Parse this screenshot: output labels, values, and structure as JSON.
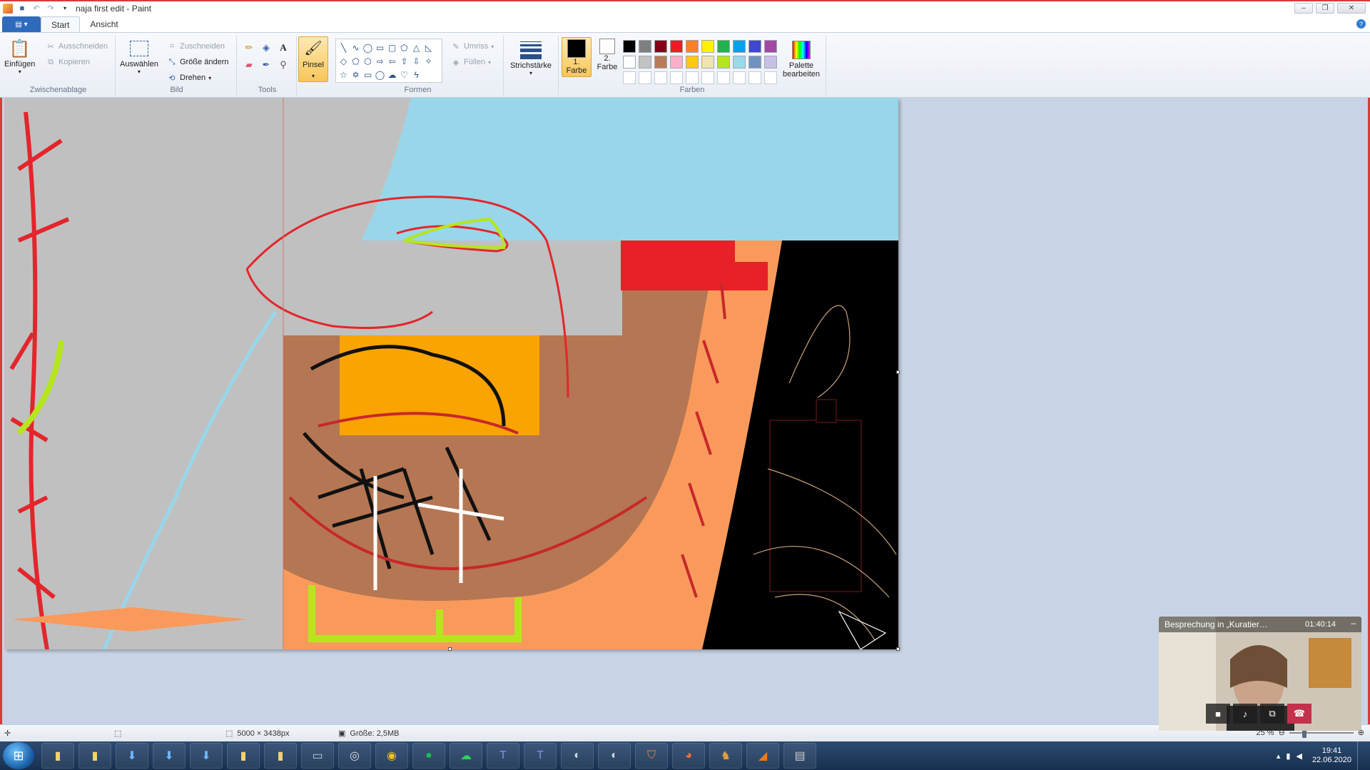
{
  "window": {
    "title": "naja first edit - Paint"
  },
  "tabs": [
    {
      "label": "Start"
    },
    {
      "label": "Ansicht"
    }
  ],
  "ribbon": {
    "clipboard": {
      "label": "Zwischenablage",
      "paste": "Einfügen",
      "cut": "Ausschneiden",
      "copy": "Kopieren"
    },
    "image": {
      "label": "Bild",
      "select": "Auswählen",
      "crop": "Zuschneiden",
      "resize": "Größe ändern",
      "rotate": "Drehen"
    },
    "tools": {
      "label": "Tools",
      "brush": "Pinsel"
    },
    "shapes": {
      "label": "Formen",
      "outline": "Umriss",
      "fill": "Füllen"
    },
    "size": {
      "label": "Strichstärke"
    },
    "colors": {
      "label": "Farben",
      "color1": "1. Farbe",
      "color2": "2. Farbe",
      "edit": "Palette bearbeiten",
      "primary": "#000000",
      "secondary": "#ffffff",
      "palette": [
        "#000000",
        "#7f7f7f",
        "#880015",
        "#ed1c24",
        "#ff7f27",
        "#fff200",
        "#22b14c",
        "#00a2e8",
        "#3f48cc",
        "#a349a4",
        "#ffffff",
        "#c3c3c3",
        "#b97a57",
        "#ffaec9",
        "#ffc90e",
        "#efe4b0",
        "#b5e61d",
        "#99d9ea",
        "#7092be",
        "#c8bfe7",
        "#ffffff",
        "#ffffff",
        "#ffffff",
        "#ffffff",
        "#ffffff",
        "#ffffff",
        "#ffffff",
        "#ffffff",
        "#ffffff",
        "#ffffff"
      ]
    }
  },
  "statusbar": {
    "dimensions": "5000 × 3438px",
    "size": "Größe: 2,5MB",
    "zoom": "25 %"
  },
  "call": {
    "title": "Besprechung in „Kuratier…",
    "time": "01:40:14"
  },
  "tray": {
    "time": "19:41",
    "date": "22.06.2020"
  },
  "icons": {
    "start": "windows-start-icon"
  }
}
